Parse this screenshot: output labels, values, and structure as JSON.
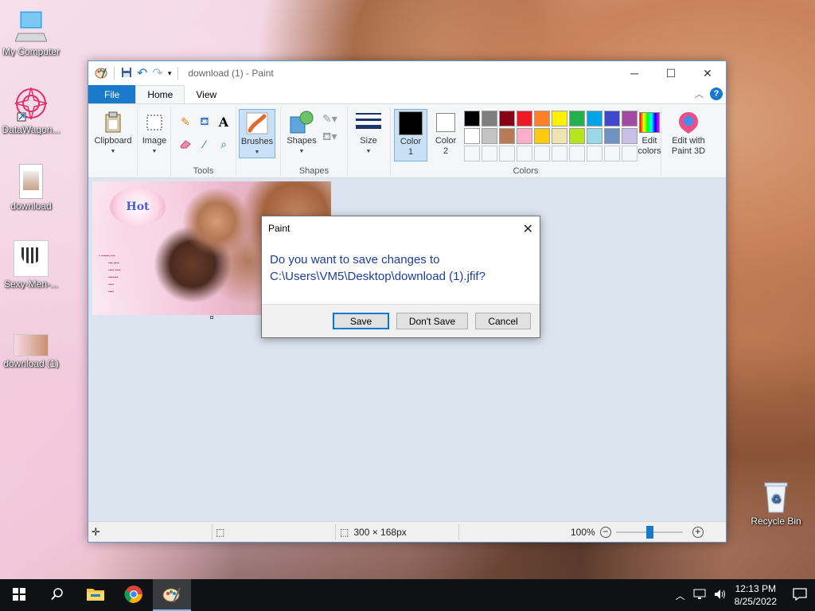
{
  "desktop": {
    "icons": [
      {
        "label": "My Computer"
      },
      {
        "label": "DataWagon..."
      },
      {
        "label": "download"
      },
      {
        "label": "Sexy-Men-..."
      },
      {
        "label": "download (1)"
      },
      {
        "label": "Recycle Bin"
      }
    ]
  },
  "window": {
    "title": "download (1) - Paint",
    "tabs": [
      "File",
      "Home",
      "View"
    ],
    "ribbon": {
      "clipboard": "Clipboard",
      "image": "Image",
      "tools_group": "Tools",
      "brushes": "Brushes",
      "shapes": "Shapes",
      "shapes_group": "Shapes",
      "size": "Size",
      "color1": "Color 1",
      "color2": "Color 2",
      "colors_group": "Colors",
      "edit_colors": "Edit colors",
      "edit_paint3d": "Edit with Paint 3D"
    },
    "palette_row1": [
      "#000000",
      "#7f7f7f",
      "#880015",
      "#ed1c24",
      "#ff7f27",
      "#fff200",
      "#22b14c",
      "#00a2e8",
      "#3f48cc",
      "#a349a4"
    ],
    "palette_row2": [
      "#ffffff",
      "#c3c3c3",
      "#b97a57",
      "#ffaec9",
      "#ffc90e",
      "#efe4b0",
      "#b5e61d",
      "#99d9ea",
      "#7092be",
      "#c8bfe7"
    ],
    "canvas": {
      "logo_text": "Hot"
    },
    "status": {
      "dimensions": "300 × 168px",
      "zoom": "100%",
      "zoom_level": 0.5
    }
  },
  "dialog": {
    "title": "Paint",
    "message_line1": "Do you want to save changes to",
    "message_line2": "C:\\Users\\VM5\\Desktop\\download (1).jfif?",
    "save": "Save",
    "dont_save": "Don't Save",
    "cancel": "Cancel"
  },
  "taskbar": {
    "time": "12:13 PM",
    "date": "8/25/2022"
  }
}
